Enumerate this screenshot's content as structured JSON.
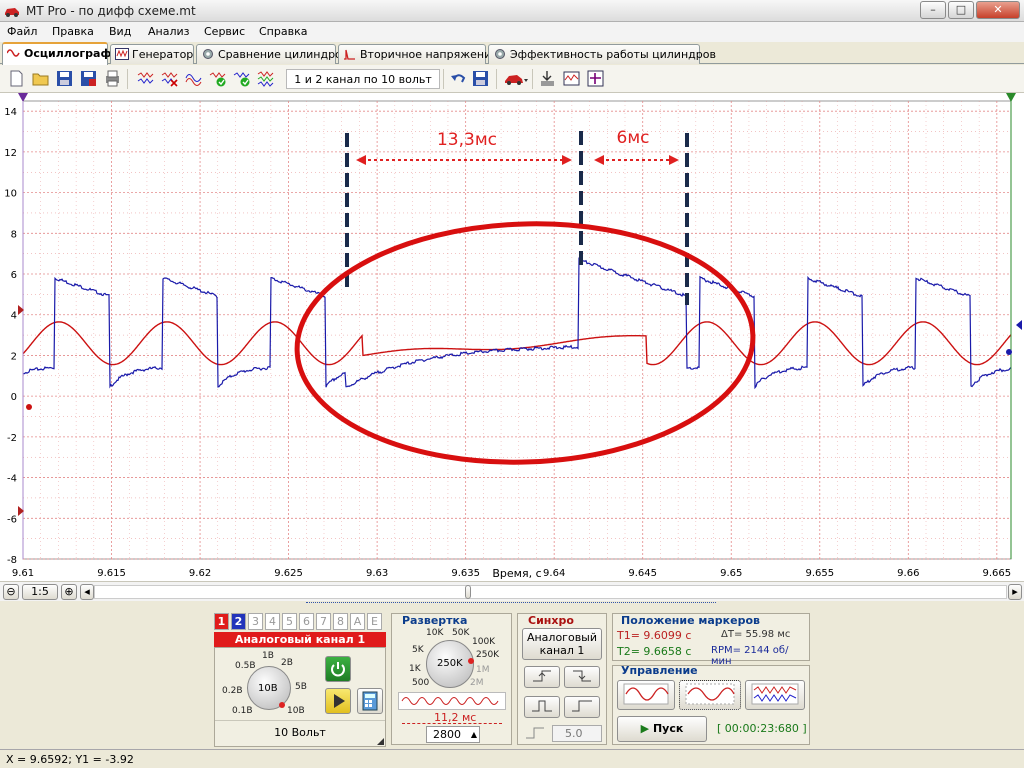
{
  "window": {
    "title": "MT Pro - по дифф схеме.mt",
    "min": "–",
    "max": "□",
    "close": "✕"
  },
  "menu": [
    "Файл",
    "Правка",
    "Вид",
    "Анализ",
    "Сервис",
    "Справка"
  ],
  "tabs": [
    {
      "label": "Осциллограф",
      "active": true
    },
    {
      "label": "Генератор"
    },
    {
      "label": "Сравнение цилиндров"
    },
    {
      "label": "Вторичное напряжение"
    },
    {
      "label": "Эффективность работы цилиндров"
    }
  ],
  "toolbar": {
    "channel_preset": "1 и 2 канал по 10 вольт"
  },
  "scope": {
    "y_ticks": [
      "14",
      "12",
      "10",
      "8",
      "6",
      "4",
      "2",
      "0",
      "-2",
      "-4",
      "-6",
      "-8"
    ],
    "x_ticks": [
      "9.61",
      "9.615",
      "9.62",
      "9.625",
      "9.63",
      "9.635",
      "9.64",
      "9.645",
      "9.65",
      "9.655",
      "9.66",
      "9.665"
    ],
    "x_label": "Время, с",
    "annotation_1": "13,3мс",
    "annotation_2": "6мс",
    "colors": {
      "ch1": "#cc1111",
      "ch2": "#1a1aaa",
      "grid": "#e48a8a",
      "annot": "#e02020"
    }
  },
  "hscroll": {
    "zoom": "1:5"
  },
  "channel_panel": {
    "tabs": [
      "1",
      "2",
      "3",
      "4",
      "5",
      "6",
      "7",
      "8",
      "A",
      "E"
    ],
    "title": "Аналоговый канал 1",
    "knob_labels": {
      "a": "1В",
      "b": "2В",
      "c": "0.5В",
      "d": "5В",
      "e": "0.2В",
      "f": "0.1В",
      "g": "10В",
      "center": "10В"
    },
    "range": "10 Вольт"
  },
  "sweep": {
    "title": "Развертка",
    "knob_labels": {
      "a": "10K",
      "b": "50K",
      "c": "5K",
      "d": "100K",
      "e": "250K",
      "f": "1K",
      "g": "1M",
      "h": "500",
      "i": "2M",
      "center": "250K"
    },
    "time": "11,2 мс",
    "points": "2800"
  },
  "sync": {
    "title": "Синхро",
    "source_line1": "Аналоговый",
    "source_line2": "канал 1",
    "level": "5.0"
  },
  "markers": {
    "title": "Положение маркеров",
    "t1": "T1= 9.6099 с",
    "t2": "T2= 9.6658 с",
    "dt": "ΔT= 55.98 мс",
    "rpm": "RPM= 2144 об/мин"
  },
  "control": {
    "title": "Управление",
    "start": "Пуск",
    "timer": "[ 00:00:23:680 ]"
  },
  "status": {
    "coords": "X = 9.6592; Y1 = -3.92"
  }
}
